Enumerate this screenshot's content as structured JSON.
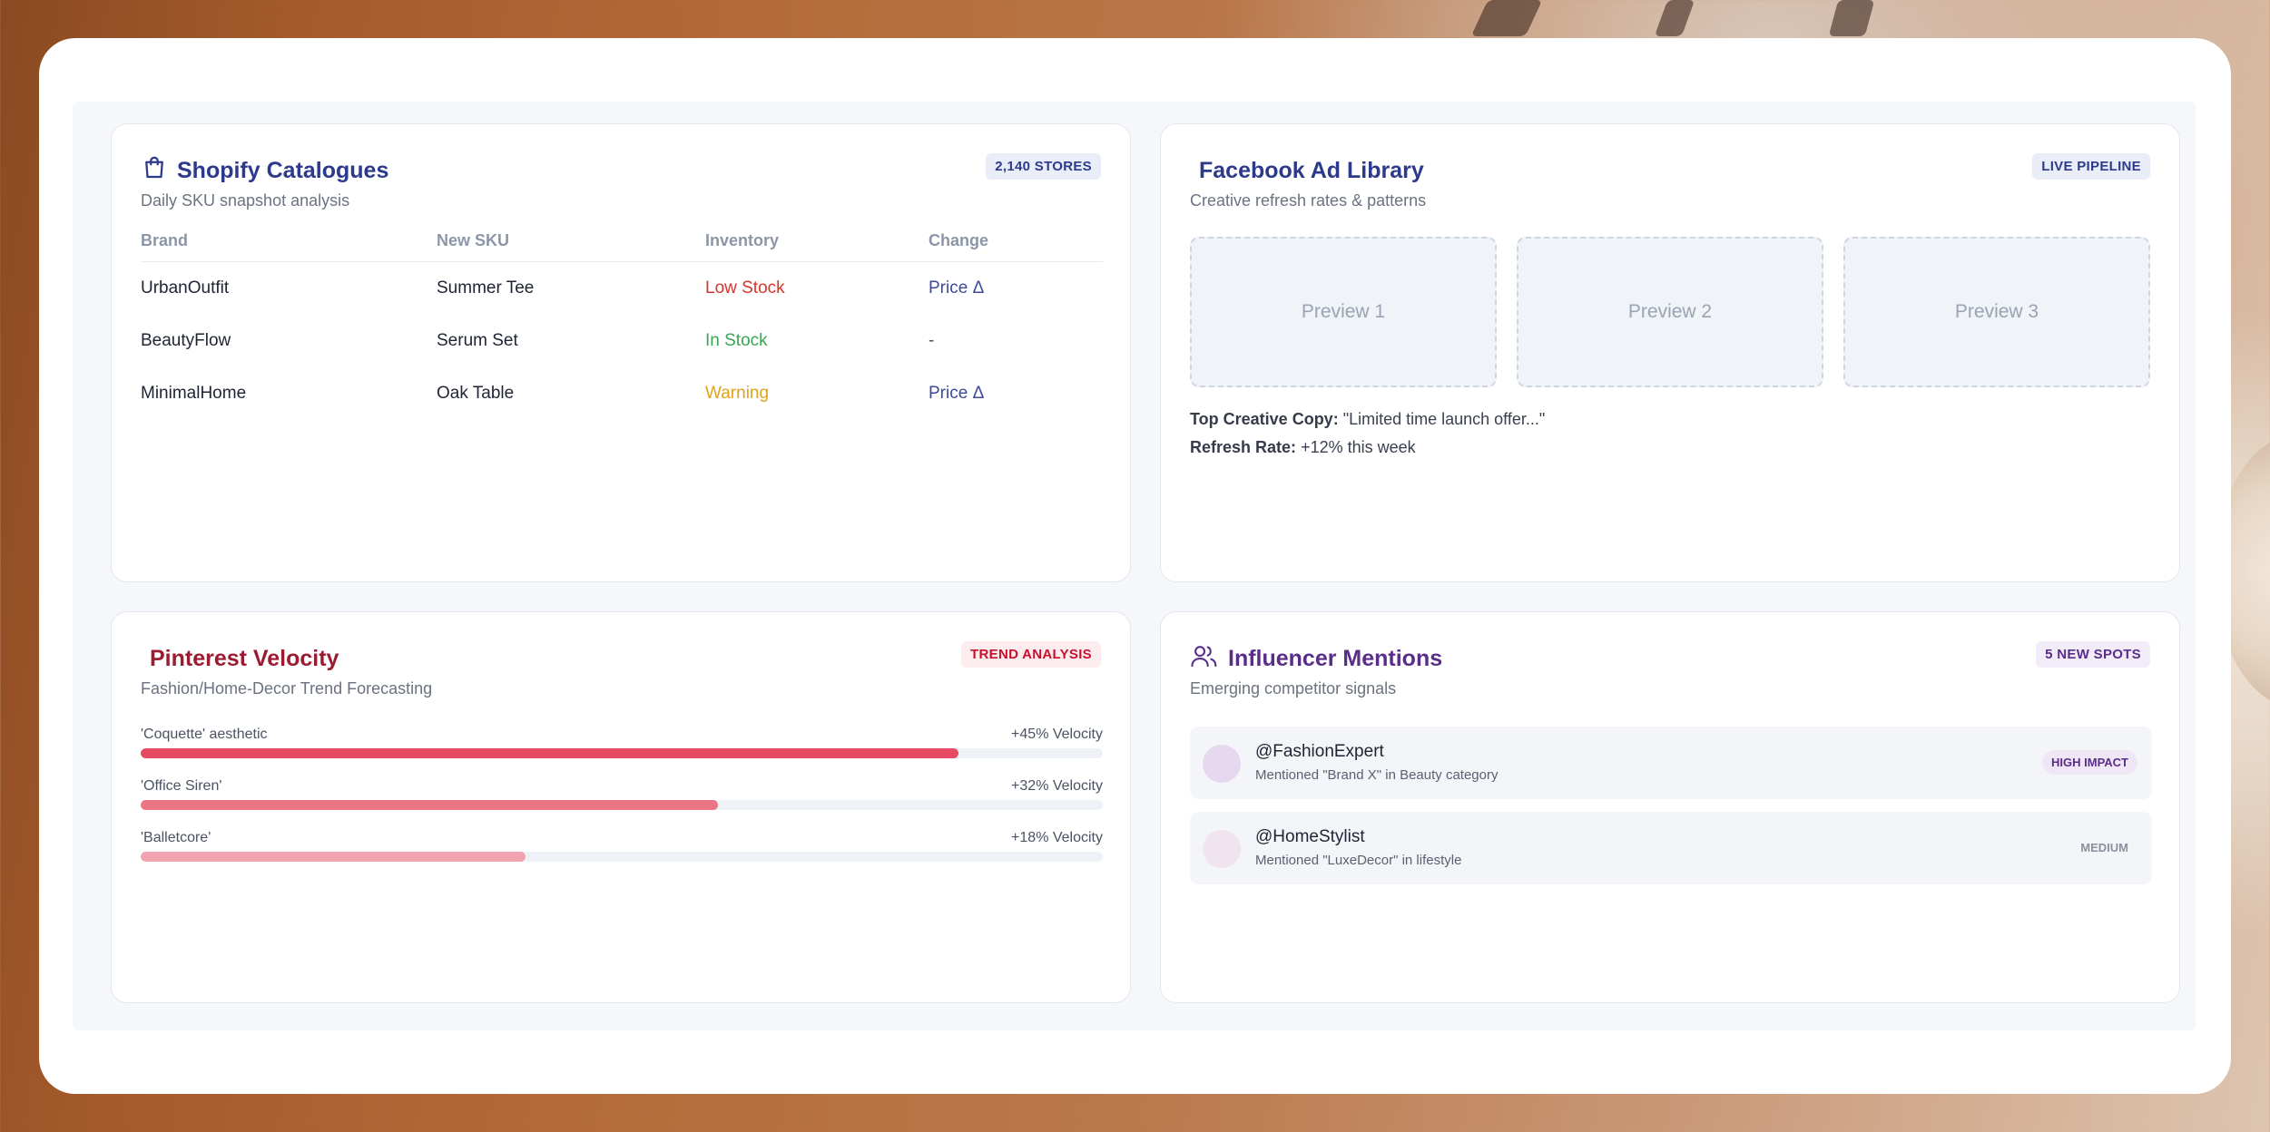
{
  "colors": {
    "accent_navy": "#2d3a8c",
    "pinterest_red": "#9b1b30",
    "influencer_purple": "#5b2d8a",
    "low_stock": "#d9342b",
    "in_stock": "#3aa655",
    "warning": "#e0a21b",
    "price_delta": "#3b4a9c"
  },
  "shopify": {
    "icon": "shopping-bag-icon",
    "title": "Shopify Catalogues",
    "subtitle": "Daily SKU snapshot analysis",
    "badge": "2,140 STORES",
    "columns": [
      "Brand",
      "New SKU",
      "Inventory",
      "Change"
    ],
    "rows": [
      {
        "brand": "UrbanOutfit",
        "sku": "Summer Tee",
        "inventory": "Low Stock",
        "change": "Price Δ"
      },
      {
        "brand": "BeautyFlow",
        "sku": "Serum Set",
        "inventory": "In Stock",
        "change": "-"
      },
      {
        "brand": "MinimalHome",
        "sku": "Oak Table",
        "inventory": "Warning",
        "change": "Price Δ"
      }
    ]
  },
  "facebook": {
    "title": "Facebook Ad Library",
    "subtitle": "Creative refresh rates & patterns",
    "badge": "LIVE PIPELINE",
    "previews": [
      "Preview 1",
      "Preview 2",
      "Preview 3"
    ],
    "top_copy_label": "Top Creative Copy:",
    "top_copy_value": "\"Limited time launch offer...\"",
    "refresh_label": "Refresh Rate:",
    "refresh_value": "+12% this week"
  },
  "pinterest": {
    "title": "Pinterest Velocity",
    "subtitle": "Fashion/Home-Decor Trend Forecasting",
    "badge": "TREND ANALYSIS",
    "trends": [
      {
        "label": "'Coquette' aesthetic",
        "value_text": "+45% Velocity",
        "fill_fraction": 0.85
      },
      {
        "label": "'Office Siren'",
        "value_text": "+32% Velocity",
        "fill_fraction": 0.6
      },
      {
        "label": "'Balletcore'",
        "value_text": "+18% Velocity",
        "fill_fraction": 0.4
      }
    ]
  },
  "influencer": {
    "icon": "users-icon",
    "title": "Influencer Mentions",
    "subtitle": "Emerging competitor signals",
    "badge": "5 NEW SPOTS",
    "items": [
      {
        "handle": "@FashionExpert",
        "description": "Mentioned \"Brand X\" in Beauty category",
        "tag": "HIGH IMPACT"
      },
      {
        "handle": "@HomeStylist",
        "description": "Mentioned \"LuxeDecor\" in lifestyle",
        "tag": "MEDIUM"
      }
    ]
  }
}
